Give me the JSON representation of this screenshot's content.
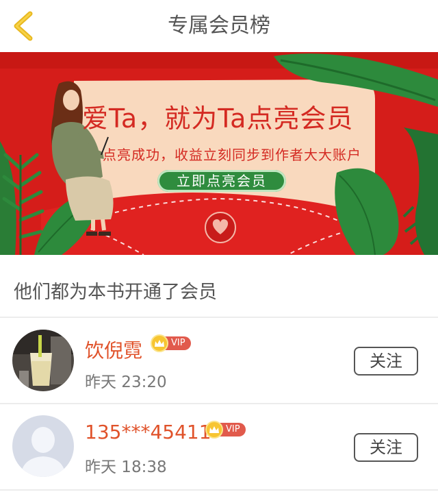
{
  "header": {
    "title": "专属会员榜",
    "back_icon": "chevron-left-icon"
  },
  "banner": {
    "headline": "爱Ta，就为Ta点亮会员",
    "subtitle": "点亮成功，收益立刻同步到作者大大账户",
    "cta_label": "立即点亮会员",
    "colors": {
      "background": "#d51d1a",
      "card": "#f9d9be",
      "leaf": "#2d8a3c",
      "cta": "#2f8c3e"
    }
  },
  "section": {
    "title": "他们都为本书开通了会员"
  },
  "members": [
    {
      "name": "饮倪霓",
      "vip_label": "VIP",
      "time": "昨天 23:20",
      "follow_label": "关注",
      "avatar": "drink-photo"
    },
    {
      "name": "135***45411",
      "vip_label": "VIP",
      "time": "昨天 18:38",
      "follow_label": "关注",
      "avatar": "default-user-silhouette"
    }
  ],
  "colors": {
    "name": "#e0522a",
    "vip_badge": "#e15a4c",
    "crown": "#f7c531"
  }
}
